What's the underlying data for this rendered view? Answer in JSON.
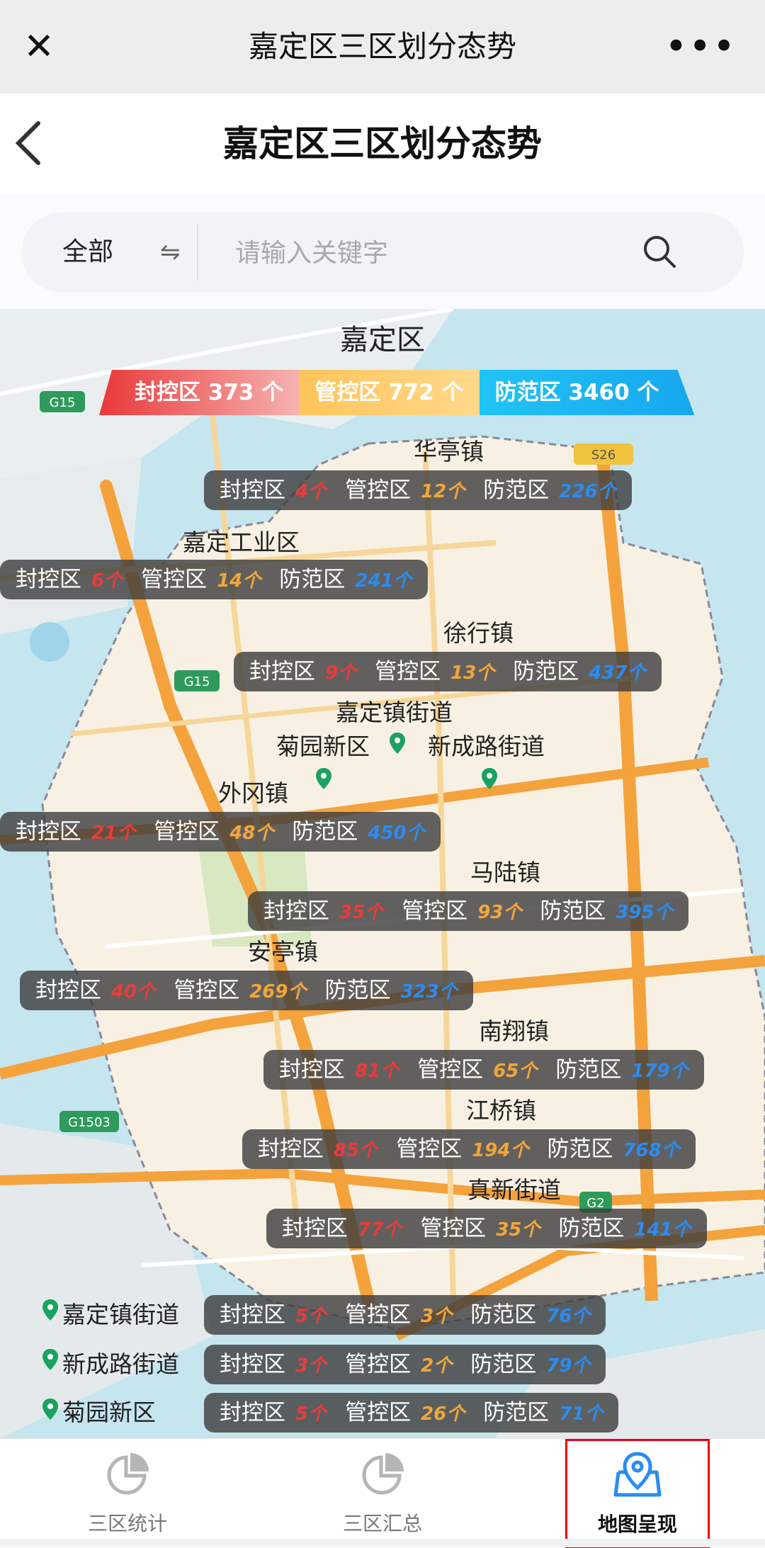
{
  "app_bar": {
    "title": "嘉定区三区划分态势"
  },
  "page_header": {
    "title": "嘉定区三区划分态势"
  },
  "search": {
    "category": "全部",
    "placeholder": "请输入关键字"
  },
  "map": {
    "district_name": "嘉定区",
    "road_labels": [
      "G15",
      "S26",
      "G15",
      "G1503",
      "G2"
    ],
    "summary": [
      {
        "label": "封控区 373 个"
      },
      {
        "label": "管控区 772 个"
      },
      {
        "label": "防范区 3460 个"
      }
    ],
    "towns": [
      {
        "name": "华亭镇",
        "a": "4个",
        "b": "12个",
        "c": "226个"
      },
      {
        "name": "嘉定工业区",
        "a": "6个",
        "b": "14个",
        "c": "241个"
      },
      {
        "name": "徐行镇",
        "a": "9个",
        "b": "13个",
        "c": "437个"
      },
      {
        "name": "外冈镇",
        "a": "21个",
        "b": "48个",
        "c": "450个"
      },
      {
        "name": "马陆镇",
        "a": "35个",
        "b": "93个",
        "c": "395个"
      },
      {
        "name": "安亭镇",
        "a": "40个",
        "b": "269个",
        "c": "323个"
      },
      {
        "name": "南翔镇",
        "a": "81个",
        "b": "65个",
        "c": "179个"
      },
      {
        "name": "江桥镇",
        "a": "85个",
        "b": "194个",
        "c": "768个"
      },
      {
        "name": "真新街道",
        "a": "77个",
        "b": "35个",
        "c": "141个"
      }
    ],
    "pin_labels": [
      "嘉定镇街道",
      "菊园新区",
      "新成路街道"
    ],
    "legend": [
      {
        "name": "嘉定镇街道",
        "a": "5个",
        "b": "3个",
        "c": "76个"
      },
      {
        "name": "新成路街道",
        "a": "3个",
        "b": "2个",
        "c": "79个"
      },
      {
        "name": "菊园新区",
        "a": "5个",
        "b": "26个",
        "c": "71个"
      }
    ],
    "labels": {
      "a": "封控区",
      "b": "管控区",
      "c": "防范区"
    },
    "colors": {
      "a": "#ea3b3b",
      "b": "#f2a63b",
      "c": "#2a8cf2",
      "pin": "#1aa260"
    }
  },
  "tabbar": {
    "items": [
      {
        "label": "三区统计",
        "icon": "pie-chart-icon"
      },
      {
        "label": "三区汇总",
        "icon": "pie-chart-icon"
      },
      {
        "label": "地图呈现",
        "icon": "map-pin-icon"
      }
    ]
  }
}
